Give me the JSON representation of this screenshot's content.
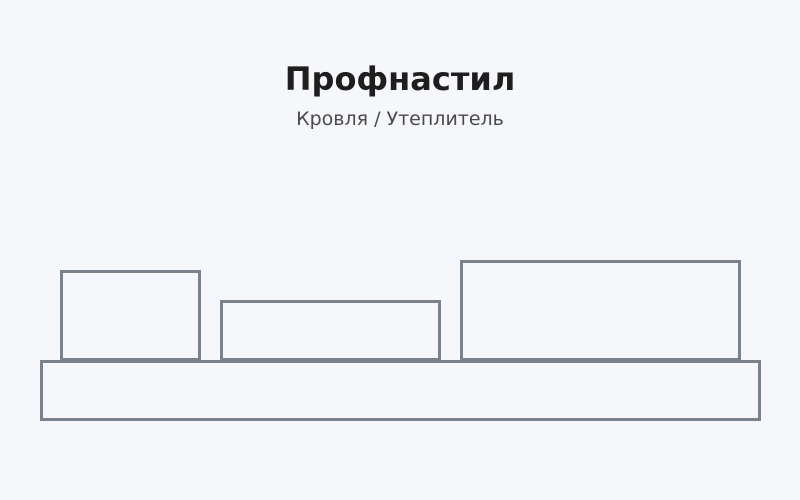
{
  "header": {
    "title": "Профнастил",
    "subtitle": "Кровля / Утеплитель"
  },
  "colors": {
    "background": "#f5f7fa",
    "outline": "#7a838d",
    "title_text": "#1e1e1e",
    "subtitle_text": "#4a4a4a"
  }
}
